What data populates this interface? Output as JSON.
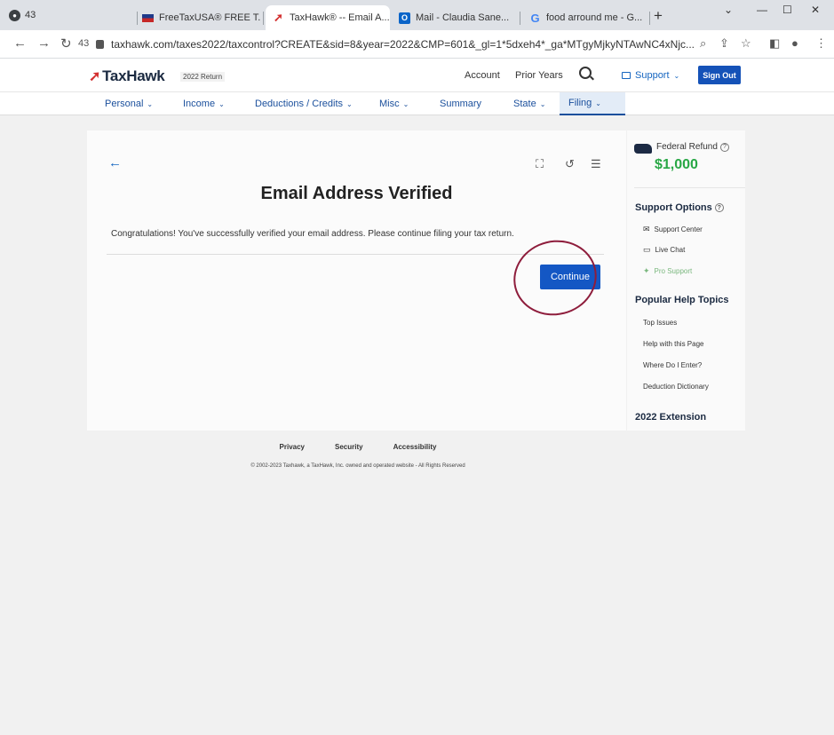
{
  "browser": {
    "tab_count": "43",
    "tabs": [
      {
        "label": "FreeTaxUSA® FREE T..."
      },
      {
        "label": "TaxHawk® -- Email A..."
      },
      {
        "label": "Mail - Claudia Sane..."
      },
      {
        "label": "food arround me - G..."
      }
    ],
    "history_count": "43",
    "url": "taxhawk.com/taxes2022/taxcontrol?CREATE&sid=8&year=2022&CMP=601&_gl=1*5dxeh4*_ga*MTgyMjkyNTAwNC4xNjc..."
  },
  "header": {
    "logo_text": "TaxHawk",
    "year_badge": "2022 Return",
    "account": "Account",
    "prior_years": "Prior Years",
    "support": "Support",
    "sign_out": "Sign Out"
  },
  "nav": {
    "tabs": [
      {
        "label": "Personal"
      },
      {
        "label": "Income"
      },
      {
        "label": "Deductions / Credits"
      },
      {
        "label": "Misc"
      },
      {
        "label": "Summary"
      },
      {
        "label": "State"
      },
      {
        "label": "Filing"
      }
    ]
  },
  "main": {
    "title": "Email Address Verified",
    "message": "Congratulations! You've successfully verified your email address. Please continue filing your tax return.",
    "continue": "Continue"
  },
  "sidebar": {
    "federal_refund_label": "Federal Refund",
    "federal_refund_amount": "$1,000",
    "support_options": "Support Options",
    "support_items": [
      {
        "label": "Support Center"
      },
      {
        "label": "Live Chat"
      },
      {
        "label": "Pro Support"
      }
    ],
    "popular_help": "Popular Help Topics",
    "help_items": [
      {
        "label": "Top Issues"
      },
      {
        "label": "Help with this Page"
      },
      {
        "label": "Where Do I Enter?"
      },
      {
        "label": "Deduction Dictionary"
      }
    ],
    "extension": "2022 Extension"
  },
  "footer": {
    "links": [
      {
        "label": "Privacy"
      },
      {
        "label": "Security"
      },
      {
        "label": "Accessibility"
      }
    ],
    "copyright": "© 2002-2023 Taxhawk, a TaxHawk, Inc. owned and operated website - All Rights Reserved"
  },
  "colors": {
    "brand_blue": "#1457c4",
    "refund_green": "#28a745",
    "annotation": "#8e1d3c"
  }
}
